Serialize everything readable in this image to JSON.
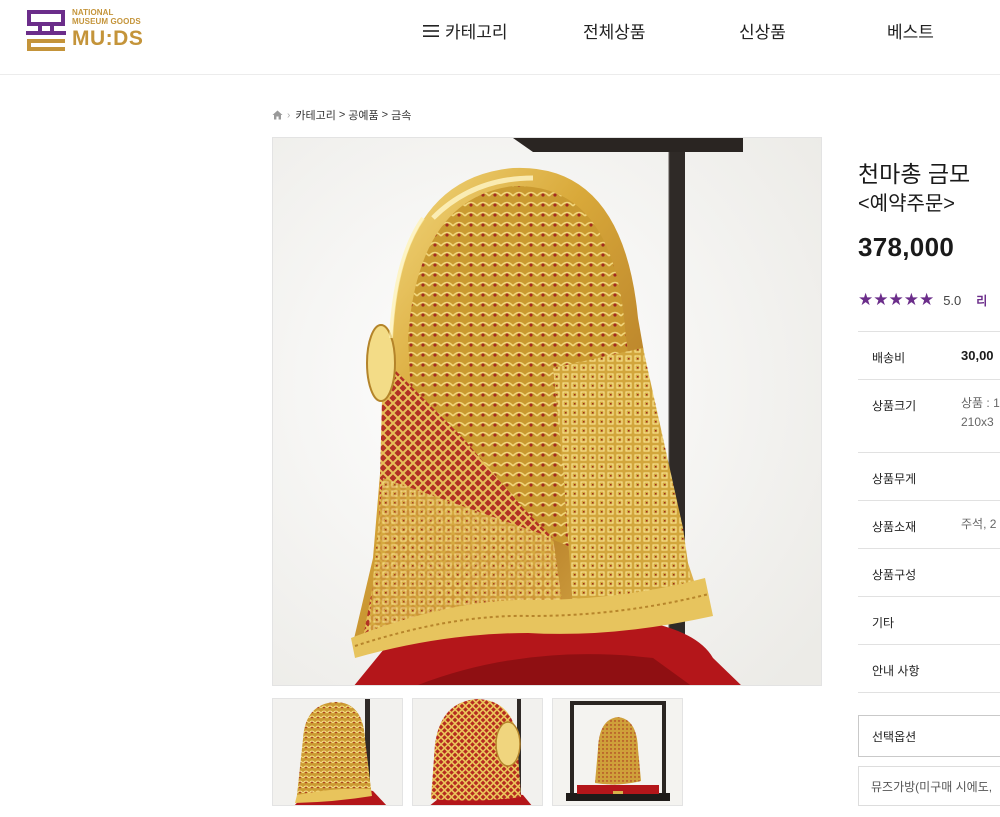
{
  "brand": {
    "small_line1": "NATIONAL",
    "small_line2": "MUSEUM GOODS",
    "name": "MU:DS",
    "colors": {
      "purple": "#6b2d8a",
      "gold": "#c4943a"
    }
  },
  "nav": {
    "category": "카테고리",
    "all_products": "전체상품",
    "new_products": "신상품",
    "best": "베스트",
    "category_icon": "hamburger-menu-icon"
  },
  "breadcrumb": {
    "home_icon": "home-icon",
    "items": [
      "카테고리",
      "공예품",
      "금속"
    ],
    "separator": ">"
  },
  "product": {
    "title": "천마총 금모",
    "subtitle": "<예약주문>",
    "price": "378,000",
    "rating": {
      "stars": 5,
      "score": "5.0",
      "link_text": "리"
    },
    "specs": [
      {
        "label": "배송비",
        "value": "30,00",
        "emphasis": true
      },
      {
        "label": "상품크기",
        "value": "상품 : 1",
        "value2": "210x3"
      },
      {
        "label": "상품무게",
        "value": ""
      },
      {
        "label": "상품소재",
        "value": "주석, 2"
      },
      {
        "label": "상품구성",
        "value": ""
      },
      {
        "label": "기타",
        "value": ""
      },
      {
        "label": "안내 사항",
        "value": ""
      }
    ],
    "option_label": "선택옵션",
    "note_text": "뮤즈가방(미구매 시에도,"
  },
  "images": {
    "main_alt_icon": "golden-crown-cap-image",
    "thumbnails": [
      "thumbnail-front-view",
      "thumbnail-side-view",
      "thumbnail-display-case"
    ]
  }
}
